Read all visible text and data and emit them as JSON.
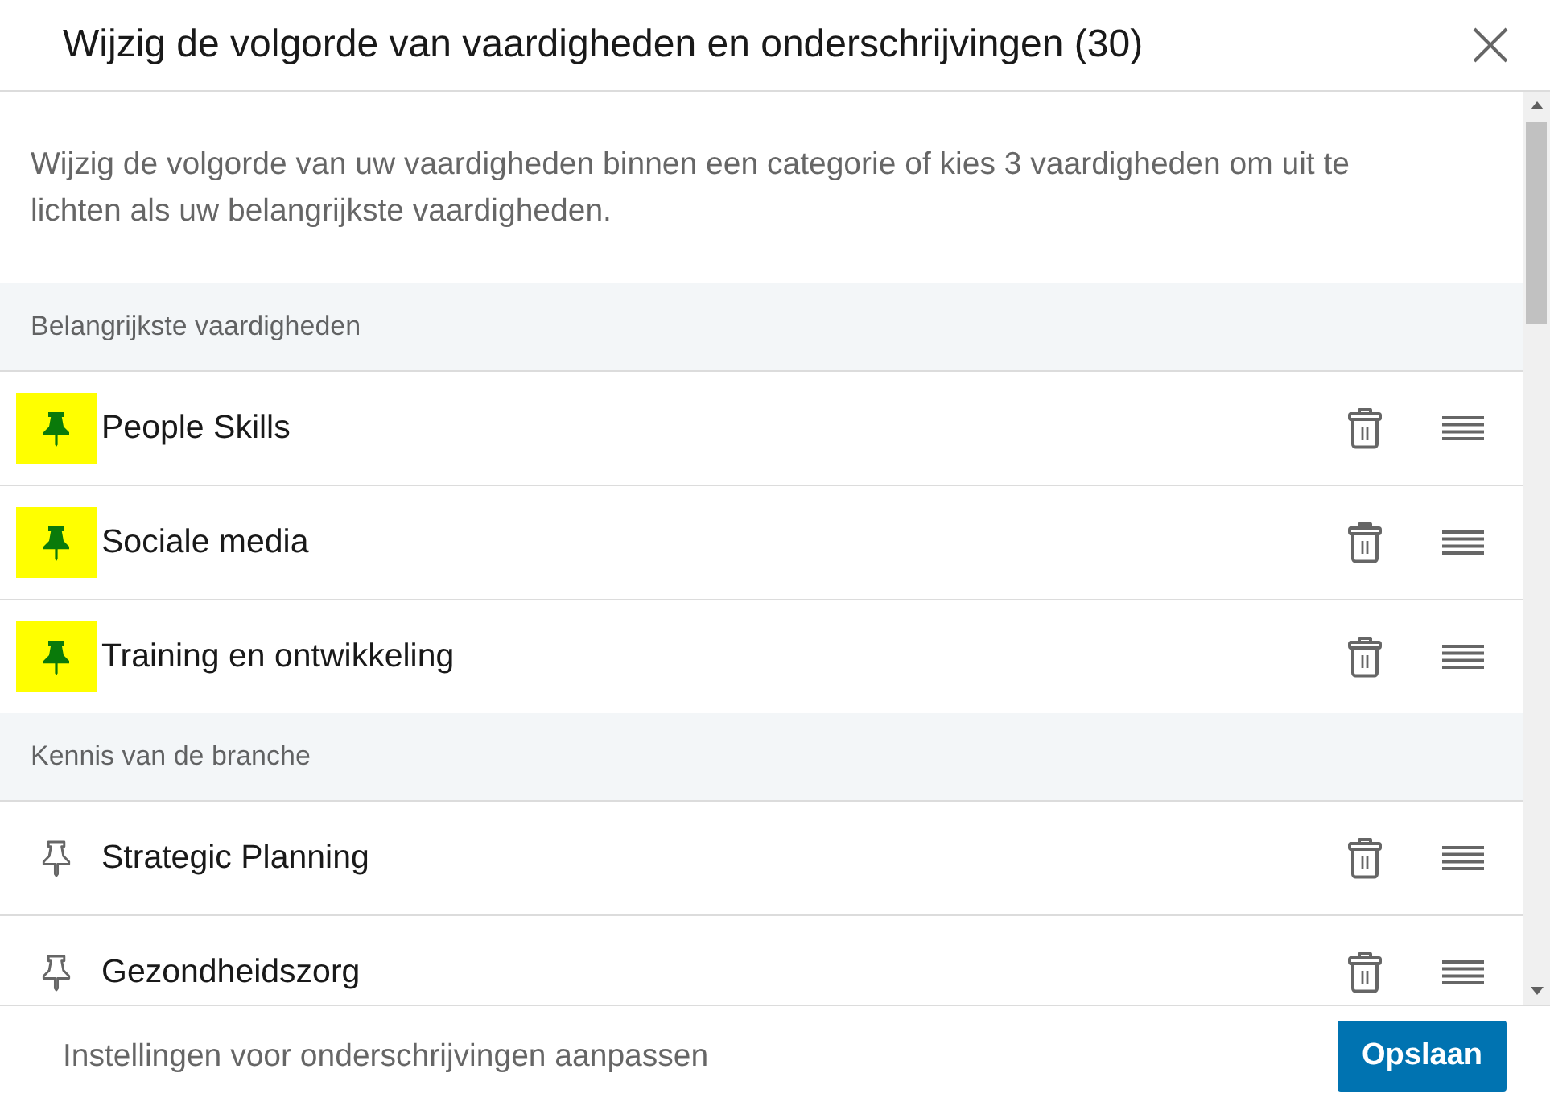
{
  "dialog": {
    "title": "Wijzig de volgorde van vaardigheden en onderschrijvingen (30)",
    "description": "Wijzig de volgorde van uw vaardigheden binnen een categorie of kies 3 vaardigheden om uit te lichten als uw belangrijkste vaardigheden."
  },
  "sections": [
    {
      "heading": "Belangrijkste vaardigheden",
      "skills": [
        {
          "name": "People Skills",
          "pinned": true
        },
        {
          "name": "Sociale media",
          "pinned": true
        },
        {
          "name": "Training en ontwikkeling",
          "pinned": true
        }
      ]
    },
    {
      "heading": "Kennis van de branche",
      "skills": [
        {
          "name": "Strategic Planning",
          "pinned": false
        },
        {
          "name": "Gezondheidszorg",
          "pinned": false
        }
      ]
    }
  ],
  "footer": {
    "link": "Instellingen voor onderschrijvingen aanpassen",
    "button": "Opslaan"
  }
}
